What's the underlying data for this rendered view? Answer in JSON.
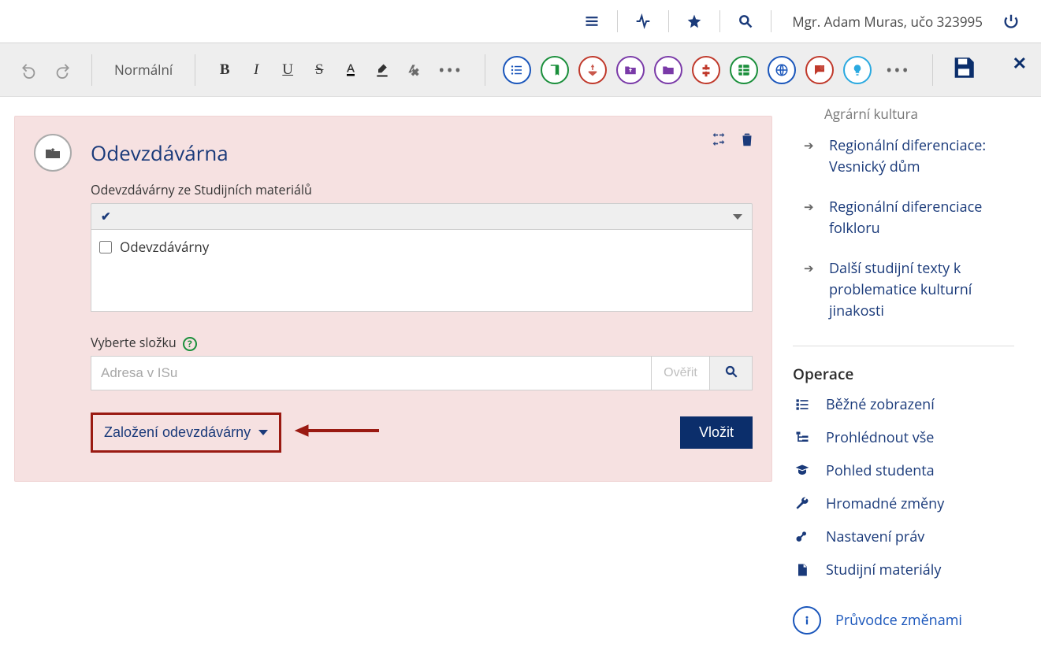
{
  "topbar": {
    "user": "Mgr. Adam Muras, učo 323995"
  },
  "editor": {
    "style_dropdown": "Normální"
  },
  "card": {
    "title": "Odevzdávárna",
    "subtitle": "Odevzdávárny ze Studijních materiálů",
    "listbox_item": "Odevzdávárny",
    "folder_label": "Vyberte složku",
    "address_placeholder": "Adresa v ISu",
    "verify_btn": "Ověřit",
    "create_dropdown": "Založení odevzdávárny",
    "insert_btn": "Vložit"
  },
  "sidebar": {
    "truncated_top": "Agrární kultura",
    "nav": [
      "Regionální diferenciace: Vesnický dům",
      "Regionální diferenciace folkloru",
      "Další studijní texty k problematice kulturní jinakosti"
    ],
    "ops_heading": "Operace",
    "ops": [
      "Běžné zobrazení",
      "Prohlédnout vše",
      "Pohled studenta",
      "Hromadné změny",
      "Nastavení práv",
      "Studijní materiály"
    ],
    "guide": "Průvodce změnami"
  }
}
